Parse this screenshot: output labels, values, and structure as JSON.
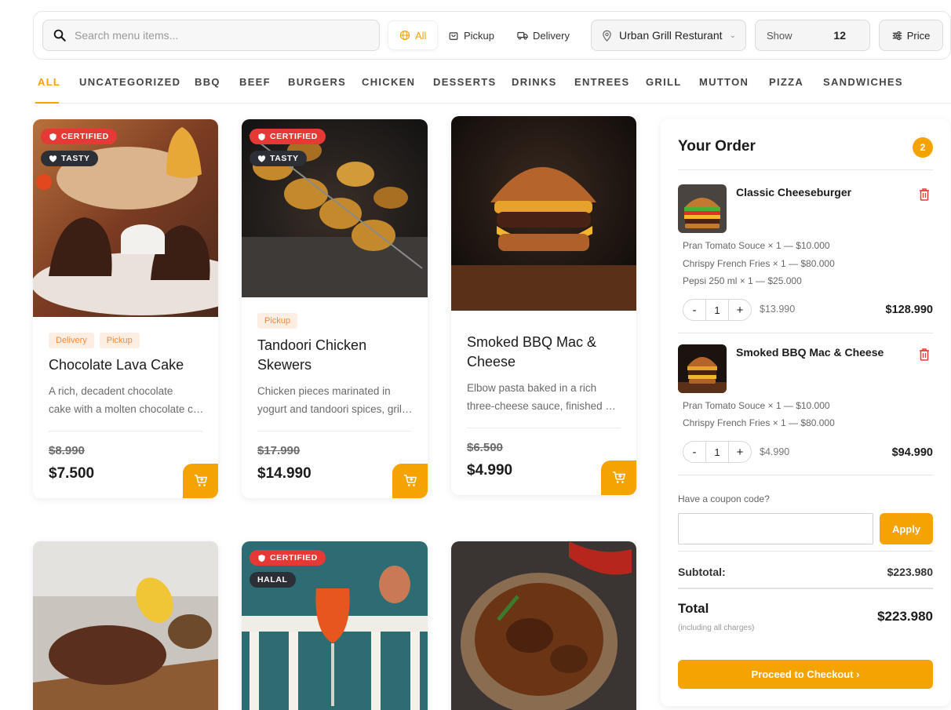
{
  "search": {
    "placeholder": "Search menu items..."
  },
  "modes": {
    "all": "All",
    "pickup": "Pickup",
    "delivery": "Delivery"
  },
  "location": {
    "label": "Urban Grill Resturant"
  },
  "show": {
    "label": "Show",
    "value": "12"
  },
  "price_filter": {
    "label": "Price"
  },
  "categories": [
    "ALL",
    "UNCATEGORIZED",
    "BBQ",
    "BEEF",
    "BURGERS",
    "CHICKEN",
    "DESSERTS",
    "DRINKS",
    "ENTREES",
    "GRILL",
    "MUTTON",
    "PIZZA",
    "SANDWICHES"
  ],
  "active_category": "ALL",
  "products": [
    {
      "title": "Chocolate Lava Cake",
      "badges": [
        "CERTIFIED",
        "TASTY"
      ],
      "tags": [
        "Delivery",
        "Pickup"
      ],
      "desc_lines": [
        "A rich, decadent chocolate",
        "cake with a molten chocolate center"
      ],
      "old_price": "$8.990",
      "price": "$7.500"
    },
    {
      "title": "Tandoori Chicken Skewers",
      "badges": [
        "CERTIFIED",
        "TASTY"
      ],
      "tags": [
        "Pickup"
      ],
      "desc_lines": [
        "Chicken pieces marinated in",
        "yogurt and tandoori spices, grilled"
      ],
      "old_price": "$17.990",
      "price": "$14.990"
    },
    {
      "title": "Smoked BBQ Mac & Cheese",
      "badges": [],
      "tags": [],
      "desc_lines": [
        "Elbow pasta baked in a rich",
        "three-cheese sauce, finished with"
      ],
      "old_price": "$6.500",
      "price": "$4.990"
    },
    {
      "title": "",
      "badges": []
    },
    {
      "title": "",
      "badges": [
        "CERTIFIED",
        "HALAL"
      ]
    },
    {
      "title": "",
      "badges": []
    }
  ],
  "order": {
    "title": "Your Order",
    "count": "2",
    "items": [
      {
        "name": "Classic Cheeseburger",
        "addons": [
          "Pran Tomato Souce × 1 — $10.000",
          "Chrispy French Fries × 1 — $80.000",
          "Pepsi 250 ml × 1 — $25.000"
        ],
        "qty": "1",
        "unit_price": "$13.990",
        "total": "$128.990"
      },
      {
        "name": "Smoked BBQ Mac & Cheese",
        "addons": [
          "Pran Tomato Souce × 1 — $10.000",
          "Chrispy French Fries × 1 — $80.000"
        ],
        "qty": "1",
        "unit_price": "$4.990",
        "total": "$94.990"
      }
    ],
    "stepper": {
      "minus": "-",
      "plus": "+"
    },
    "coupon_label": "Have a coupon code?",
    "coupon_value": "",
    "apply_label": "Apply",
    "subtotal_label": "Subtotal:",
    "subtotal": "$223.980",
    "total_label": "Total",
    "total_note": "(including all charges)",
    "total": "$223.980",
    "checkout_label": "Proceed to Checkout ›"
  },
  "colors": {
    "accent": "#f5a300",
    "certified": "#e53935",
    "badge_dark": "#2c2f35",
    "tag_bg": "#fdeee4",
    "tag_text": "#f08a3c"
  }
}
